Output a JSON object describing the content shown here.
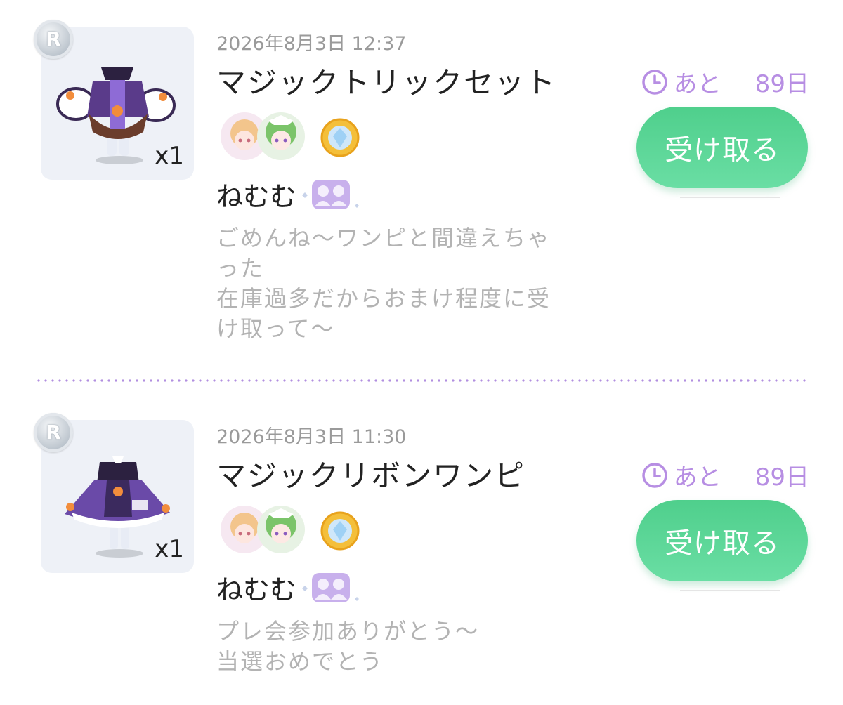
{
  "gifts": [
    {
      "rarity": "R",
      "item_icon": "outfit-set-icon",
      "quantity": "x1",
      "datetime": "2026年8月3日 12:37",
      "title": "マジックトリックセット",
      "sender": "ねむむ",
      "sender_badge_icon": "friend-badge-icon",
      "message": "ごめんね〜ワンピと間違えちゃ\nった\n在庫過多だからおまけ程度に受\nけ取って〜",
      "expiry_prefix": "あと",
      "expiry_days": "89日",
      "button_label": "受け取る"
    },
    {
      "rarity": "R",
      "item_icon": "dress-icon",
      "quantity": "x1",
      "datetime": "2026年8月3日 11:30",
      "title": "マジックリボンワンピ",
      "sender": "ねむむ",
      "sender_badge_icon": "friend-badge-icon",
      "message": "プレ会参加ありがとう〜\n当選おめでとう",
      "expiry_prefix": "あと",
      "expiry_days": "89日",
      "button_label": "受け取る"
    }
  ],
  "colors": {
    "accent_purple": "#b78ee3",
    "button_green": "#4fcf8c",
    "muted_text": "#b3b3b3"
  }
}
